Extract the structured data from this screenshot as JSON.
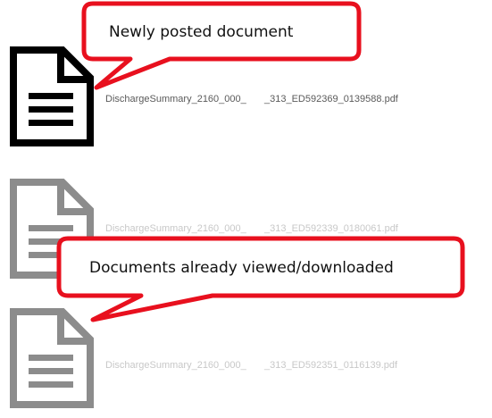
{
  "callouts": {
    "new": "Newly posted document",
    "viewed": "Documents already viewed/downloaded"
  },
  "documents": [
    {
      "status": "new",
      "icon": "document-icon",
      "name_start": "DischargeSummary_2160_000_",
      "name_end": "_313_ED592369_0139588.pdf"
    },
    {
      "status": "viewed",
      "icon": "document-icon",
      "name_start": "DischargeSummary_2160_000_",
      "name_end": "_313_ED592339_0180061.pdf"
    },
    {
      "status": "viewed",
      "icon": "document-icon",
      "name_start": "DischargeSummary_2160_000_",
      "name_end": "_313_ED592351_0116139.pdf"
    }
  ],
  "colors": {
    "callout_border": "#e8101e",
    "new_icon": "#000000",
    "viewed_icon": "#8c8c8c",
    "new_text": "#5a5a5a",
    "viewed_text": "#c8c8c8"
  }
}
